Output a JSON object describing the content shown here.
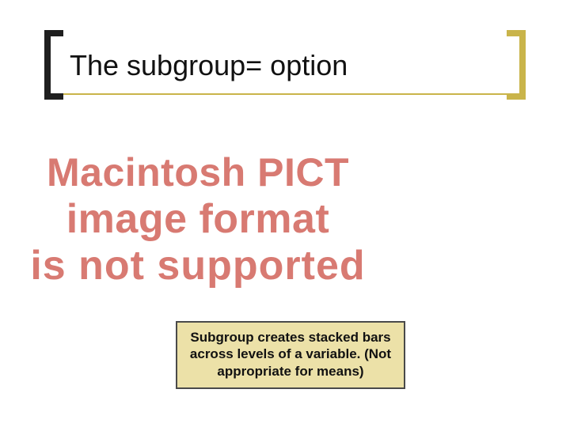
{
  "slide": {
    "title": "The subgroup= option"
  },
  "error": {
    "line1": "Macintosh PICT",
    "line2": "image format",
    "line3": "is not supported"
  },
  "caption": {
    "text": "Subgroup creates stacked bars across levels of a variable.  (Not appropriate for means)"
  }
}
